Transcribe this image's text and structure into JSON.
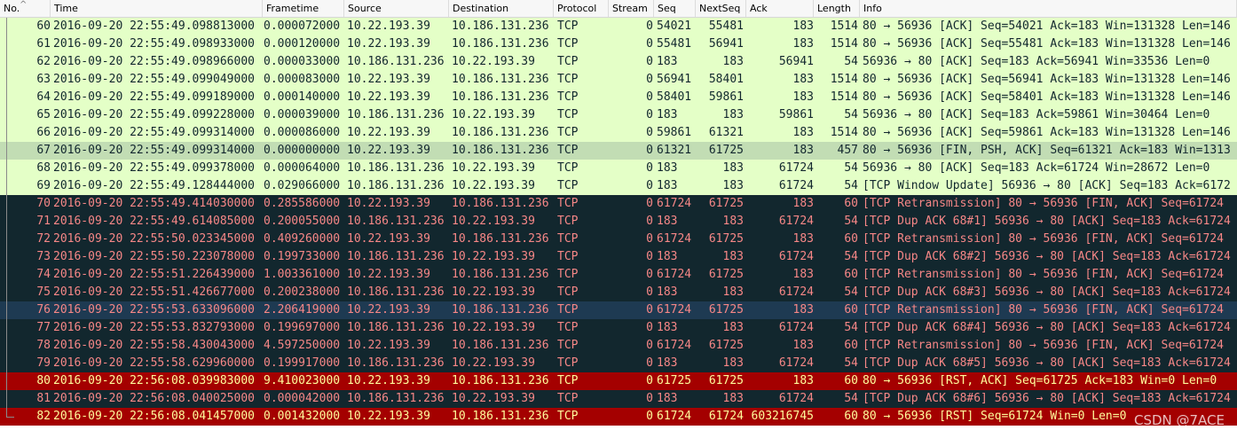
{
  "columns": [
    {
      "key": "no",
      "label": "No."
    },
    {
      "key": "time",
      "label": "Time"
    },
    {
      "key": "frametime",
      "label": "Frametime"
    },
    {
      "key": "source",
      "label": "Source"
    },
    {
      "key": "destination",
      "label": "Destination"
    },
    {
      "key": "protocol",
      "label": "Protocol"
    },
    {
      "key": "stream",
      "label": "Stream"
    },
    {
      "key": "seq",
      "label": "Seq"
    },
    {
      "key": "nextseq",
      "label": "NextSeq"
    },
    {
      "key": "ack",
      "label": "Ack"
    },
    {
      "key": "length",
      "label": "Length"
    },
    {
      "key": "info",
      "label": "Info"
    }
  ],
  "sort_icon": "caret-up-icon",
  "colors": {
    "green_bg": "#e4ffc7",
    "selected_bg": "#c2ddb4",
    "dark_bg": "#12272e",
    "dark_fg": "#f78787",
    "red_bg": "#a40000",
    "red_fg": "#fffc9c"
  },
  "rows": [
    {
      "no": "60",
      "time": "2016-09-20 22:55:49.098813000",
      "frametime": "0.000072000",
      "source": "10.22.193.39",
      "destination": "10.186.131.236",
      "protocol": "TCP",
      "stream": "0",
      "seq": "54021",
      "nextseq": "55481",
      "ack": "183",
      "length": "1514",
      "info": "80 → 56936 [ACK] Seq=54021 Ack=183 Win=131328 Len=146",
      "style": "green"
    },
    {
      "no": "61",
      "time": "2016-09-20 22:55:49.098933000",
      "frametime": "0.000120000",
      "source": "10.22.193.39",
      "destination": "10.186.131.236",
      "protocol": "TCP",
      "stream": "0",
      "seq": "55481",
      "nextseq": "56941",
      "ack": "183",
      "length": "1514",
      "info": "80 → 56936 [ACK] Seq=55481 Ack=183 Win=131328 Len=146",
      "style": "green"
    },
    {
      "no": "62",
      "time": "2016-09-20 22:55:49.098966000",
      "frametime": "0.000033000",
      "source": "10.186.131.236",
      "destination": "10.22.193.39",
      "protocol": "TCP",
      "stream": "0",
      "seq": "183",
      "nextseq": "183",
      "ack": "56941",
      "length": "54",
      "info": "56936 → 80 [ACK] Seq=183 Ack=56941 Win=33536 Len=0",
      "style": "green"
    },
    {
      "no": "63",
      "time": "2016-09-20 22:55:49.099049000",
      "frametime": "0.000083000",
      "source": "10.22.193.39",
      "destination": "10.186.131.236",
      "protocol": "TCP",
      "stream": "0",
      "seq": "56941",
      "nextseq": "58401",
      "ack": "183",
      "length": "1514",
      "info": "80 → 56936 [ACK] Seq=56941 Ack=183 Win=131328 Len=146",
      "style": "green"
    },
    {
      "no": "64",
      "time": "2016-09-20 22:55:49.099189000",
      "frametime": "0.000140000",
      "source": "10.22.193.39",
      "destination": "10.186.131.236",
      "protocol": "TCP",
      "stream": "0",
      "seq": "58401",
      "nextseq": "59861",
      "ack": "183",
      "length": "1514",
      "info": "80 → 56936 [ACK] Seq=58401 Ack=183 Win=131328 Len=146",
      "style": "green"
    },
    {
      "no": "65",
      "time": "2016-09-20 22:55:49.099228000",
      "frametime": "0.000039000",
      "source": "10.186.131.236",
      "destination": "10.22.193.39",
      "protocol": "TCP",
      "stream": "0",
      "seq": "183",
      "nextseq": "183",
      "ack": "59861",
      "length": "54",
      "info": "56936 → 80 [ACK] Seq=183 Ack=59861 Win=30464 Len=0",
      "style": "green"
    },
    {
      "no": "66",
      "time": "2016-09-20 22:55:49.099314000",
      "frametime": "0.000086000",
      "source": "10.22.193.39",
      "destination": "10.186.131.236",
      "protocol": "TCP",
      "stream": "0",
      "seq": "59861",
      "nextseq": "61321",
      "ack": "183",
      "length": "1514",
      "info": "80 → 56936 [ACK] Seq=59861 Ack=183 Win=131328 Len=146",
      "style": "green"
    },
    {
      "no": "67",
      "time": "2016-09-20 22:55:49.099314000",
      "frametime": "0.000000000",
      "source": "10.22.193.39",
      "destination": "10.186.131.236",
      "protocol": "TCP",
      "stream": "0",
      "seq": "61321",
      "nextseq": "61725",
      "ack": "183",
      "length": "457",
      "info": "80 → 56936 [FIN, PSH, ACK] Seq=61321 Ack=183 Win=1313",
      "style": "selected"
    },
    {
      "no": "68",
      "time": "2016-09-20 22:55:49.099378000",
      "frametime": "0.000064000",
      "source": "10.186.131.236",
      "destination": "10.22.193.39",
      "protocol": "TCP",
      "stream": "0",
      "seq": "183",
      "nextseq": "183",
      "ack": "61724",
      "length": "54",
      "info": "56936 → 80 [ACK] Seq=183 Ack=61724 Win=28672 Len=0",
      "style": "green"
    },
    {
      "no": "69",
      "time": "2016-09-20 22:55:49.128444000",
      "frametime": "0.029066000",
      "source": "10.186.131.236",
      "destination": "10.22.193.39",
      "protocol": "TCP",
      "stream": "0",
      "seq": "183",
      "nextseq": "183",
      "ack": "61724",
      "length": "54",
      "info": "[TCP Window Update] 56936 → 80 [ACK] Seq=183 Ack=6172",
      "style": "green"
    },
    {
      "no": "70",
      "time": "2016-09-20 22:55:49.414030000",
      "frametime": "0.285586000",
      "source": "10.22.193.39",
      "destination": "10.186.131.236",
      "protocol": "TCP",
      "stream": "0",
      "seq": "61724",
      "nextseq": "61725",
      "ack": "183",
      "length": "60",
      "info": "[TCP Retransmission] 80 → 56936 [FIN, ACK] Seq=61724",
      "style": "dark"
    },
    {
      "no": "71",
      "time": "2016-09-20 22:55:49.614085000",
      "frametime": "0.200055000",
      "source": "10.186.131.236",
      "destination": "10.22.193.39",
      "protocol": "TCP",
      "stream": "0",
      "seq": "183",
      "nextseq": "183",
      "ack": "61724",
      "length": "54",
      "info": "[TCP Dup ACK 68#1] 56936 → 80 [ACK] Seq=183 Ack=61724",
      "style": "dark"
    },
    {
      "no": "72",
      "time": "2016-09-20 22:55:50.023345000",
      "frametime": "0.409260000",
      "source": "10.22.193.39",
      "destination": "10.186.131.236",
      "protocol": "TCP",
      "stream": "0",
      "seq": "61724",
      "nextseq": "61725",
      "ack": "183",
      "length": "60",
      "info": "[TCP Retransmission] 80 → 56936 [FIN, ACK] Seq=61724",
      "style": "dark"
    },
    {
      "no": "73",
      "time": "2016-09-20 22:55:50.223078000",
      "frametime": "0.199733000",
      "source": "10.186.131.236",
      "destination": "10.22.193.39",
      "protocol": "TCP",
      "stream": "0",
      "seq": "183",
      "nextseq": "183",
      "ack": "61724",
      "length": "54",
      "info": "[TCP Dup ACK 68#2] 56936 → 80 [ACK] Seq=183 Ack=61724",
      "style": "dark"
    },
    {
      "no": "74",
      "time": "2016-09-20 22:55:51.226439000",
      "frametime": "1.003361000",
      "source": "10.22.193.39",
      "destination": "10.186.131.236",
      "protocol": "TCP",
      "stream": "0",
      "seq": "61724",
      "nextseq": "61725",
      "ack": "183",
      "length": "60",
      "info": "[TCP Retransmission] 80 → 56936 [FIN, ACK] Seq=61724",
      "style": "dark"
    },
    {
      "no": "75",
      "time": "2016-09-20 22:55:51.426677000",
      "frametime": "0.200238000",
      "source": "10.186.131.236",
      "destination": "10.22.193.39",
      "protocol": "TCP",
      "stream": "0",
      "seq": "183",
      "nextseq": "183",
      "ack": "61724",
      "length": "54",
      "info": "[TCP Dup ACK 68#3] 56936 → 80 [ACK] Seq=183 Ack=61724",
      "style": "dark"
    },
    {
      "no": "76",
      "time": "2016-09-20 22:55:53.633096000",
      "frametime": "2.206419000",
      "source": "10.22.193.39",
      "destination": "10.186.131.236",
      "protocol": "TCP",
      "stream": "0",
      "seq": "61724",
      "nextseq": "61725",
      "ack": "183",
      "length": "60",
      "info": "[TCP Retransmission] 80 → 56936 [FIN, ACK] Seq=61724",
      "style": "darkblue"
    },
    {
      "no": "77",
      "time": "2016-09-20 22:55:53.832793000",
      "frametime": "0.199697000",
      "source": "10.186.131.236",
      "destination": "10.22.193.39",
      "protocol": "TCP",
      "stream": "0",
      "seq": "183",
      "nextseq": "183",
      "ack": "61724",
      "length": "54",
      "info": "[TCP Dup ACK 68#4] 56936 → 80 [ACK] Seq=183 Ack=61724",
      "style": "dark"
    },
    {
      "no": "78",
      "time": "2016-09-20 22:55:58.430043000",
      "frametime": "4.597250000",
      "source": "10.22.193.39",
      "destination": "10.186.131.236",
      "protocol": "TCP",
      "stream": "0",
      "seq": "61724",
      "nextseq": "61725",
      "ack": "183",
      "length": "60",
      "info": "[TCP Retransmission] 80 → 56936 [FIN, ACK] Seq=61724",
      "style": "dark"
    },
    {
      "no": "79",
      "time": "2016-09-20 22:55:58.629960000",
      "frametime": "0.199917000",
      "source": "10.186.131.236",
      "destination": "10.22.193.39",
      "protocol": "TCP",
      "stream": "0",
      "seq": "183",
      "nextseq": "183",
      "ack": "61724",
      "length": "54",
      "info": "[TCP Dup ACK 68#5] 56936 → 80 [ACK] Seq=183 Ack=61724",
      "style": "dark"
    },
    {
      "no": "80",
      "time": "2016-09-20 22:56:08.039983000",
      "frametime": "9.410023000",
      "source": "10.22.193.39",
      "destination": "10.186.131.236",
      "protocol": "TCP",
      "stream": "0",
      "seq": "61725",
      "nextseq": "61725",
      "ack": "183",
      "length": "60",
      "info": "80 → 56936 [RST, ACK] Seq=61725 Ack=183 Win=0 Len=0",
      "style": "red"
    },
    {
      "no": "81",
      "time": "2016-09-20 22:56:08.040025000",
      "frametime": "0.000042000",
      "source": "10.186.131.236",
      "destination": "10.22.193.39",
      "protocol": "TCP",
      "stream": "0",
      "seq": "183",
      "nextseq": "183",
      "ack": "61724",
      "length": "54",
      "info": "[TCP Dup ACK 68#6] 56936 → 80 [ACK] Seq=183 Ack=61724",
      "style": "dark"
    },
    {
      "no": "82",
      "time": "2016-09-20 22:56:08.041457000",
      "frametime": "0.001432000",
      "source": "10.22.193.39",
      "destination": "10.186.131.236",
      "protocol": "TCP",
      "stream": "0",
      "seq": "61724",
      "nextseq": "61724",
      "ack": "603216745",
      "length": "60",
      "info": "80 → 56936 [RST] Seq=61724 Win=0 Len=0",
      "style": "red"
    }
  ],
  "watermark": "CSDN @7ACE"
}
